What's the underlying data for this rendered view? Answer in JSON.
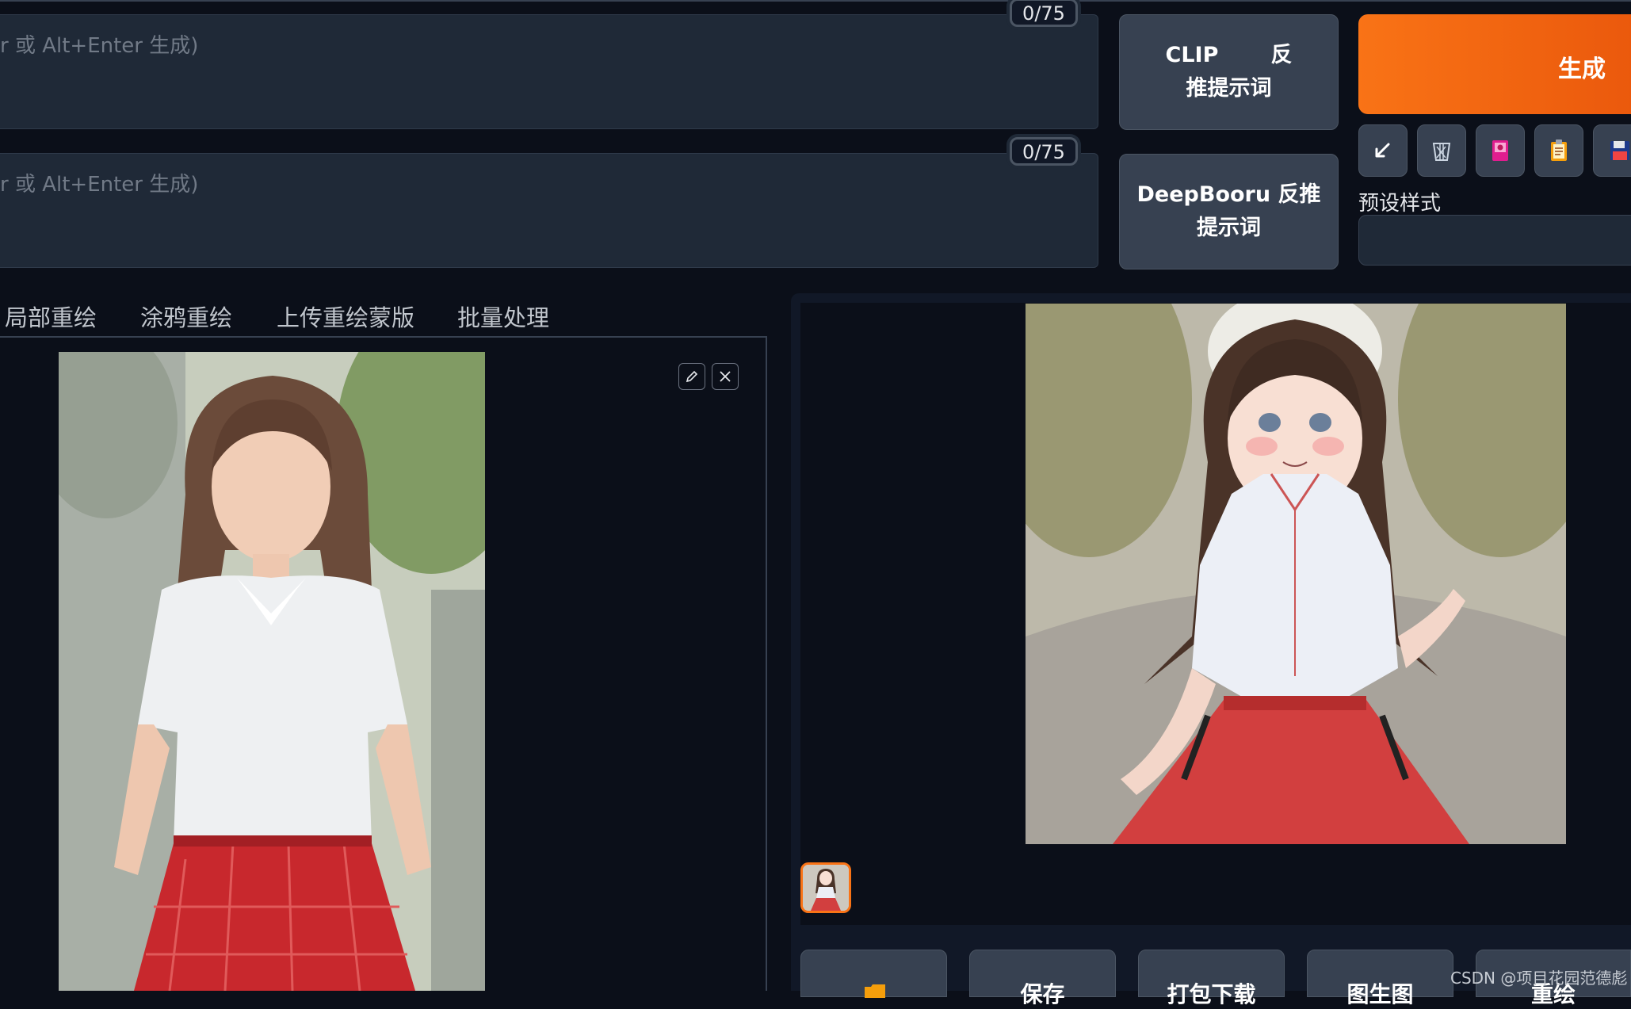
{
  "prompts": {
    "positive": {
      "placeholder": "r 或 Alt+Enter 生成)",
      "counter": "0/75"
    },
    "negative": {
      "placeholder": "r 或 Alt+Enter 生成)",
      "counter": "0/75"
    }
  },
  "buttons": {
    "clip_line1_a": "CLIP",
    "clip_line1_b": "反",
    "clip_line2": "推提示词",
    "deepbooru_line1": "DeepBooru 反推",
    "deepbooru_line2": "提示词",
    "generate": "生成"
  },
  "toolbar": {
    "icons": [
      "arrow-icon",
      "trash-icon",
      "style-icon",
      "clipboard-icon",
      "save-icon"
    ]
  },
  "preset": {
    "label": "预设样式"
  },
  "tabs": [
    "局部重绘",
    "涂鸦重绘",
    "上传重绘蒙版",
    "批量处理"
  ],
  "actions": [
    "",
    "保存",
    "打包下载",
    "图生图",
    "重绘"
  ],
  "watermark": "CSDN @项目花园范德彪",
  "colors": {
    "accent": "#f97316",
    "panel": "#1f2937",
    "background": "#0b0f19"
  }
}
